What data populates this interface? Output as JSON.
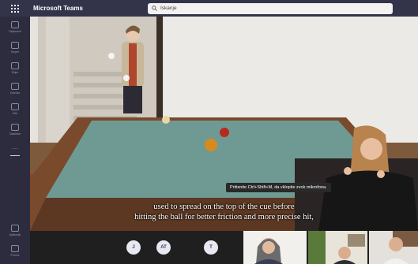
{
  "app": {
    "title": "Microsoft Teams"
  },
  "search": {
    "query": "Iskanje"
  },
  "rail": {
    "items": [
      {
        "label": "Dejavnost",
        "icon": "bell-icon"
      },
      {
        "label": "Klepet",
        "icon": "chat-icon"
      },
      {
        "label": "Ekipe",
        "icon": "teams-icon"
      },
      {
        "label": "Koledar",
        "icon": "calendar-icon"
      },
      {
        "label": "Klici",
        "icon": "phone-icon"
      },
      {
        "label": "Datoteke",
        "icon": "files-icon"
      }
    ],
    "more": "…",
    "bottom": [
      {
        "label": "Aplikacije",
        "icon": "apps-icon"
      },
      {
        "label": "Pomoč",
        "icon": "help-icon"
      }
    ]
  },
  "tooltip": {
    "text": "Pritisnite Ctrl+Shift+M, da vklopite zvok mikrofona."
  },
  "captions": {
    "line1": "used to spread on the top of the cue before",
    "line2": "hitting the ball for better friction and more precise hit,"
  },
  "participants": [
    {
      "initials": "J"
    },
    {
      "initials": "AT"
    },
    {
      "initials": "T"
    }
  ],
  "colors": {
    "topbar": "#33344a",
    "rail": "#2d2c3f",
    "table_felt": "#6f9a93",
    "table_rail": "#7a4a2c"
  }
}
